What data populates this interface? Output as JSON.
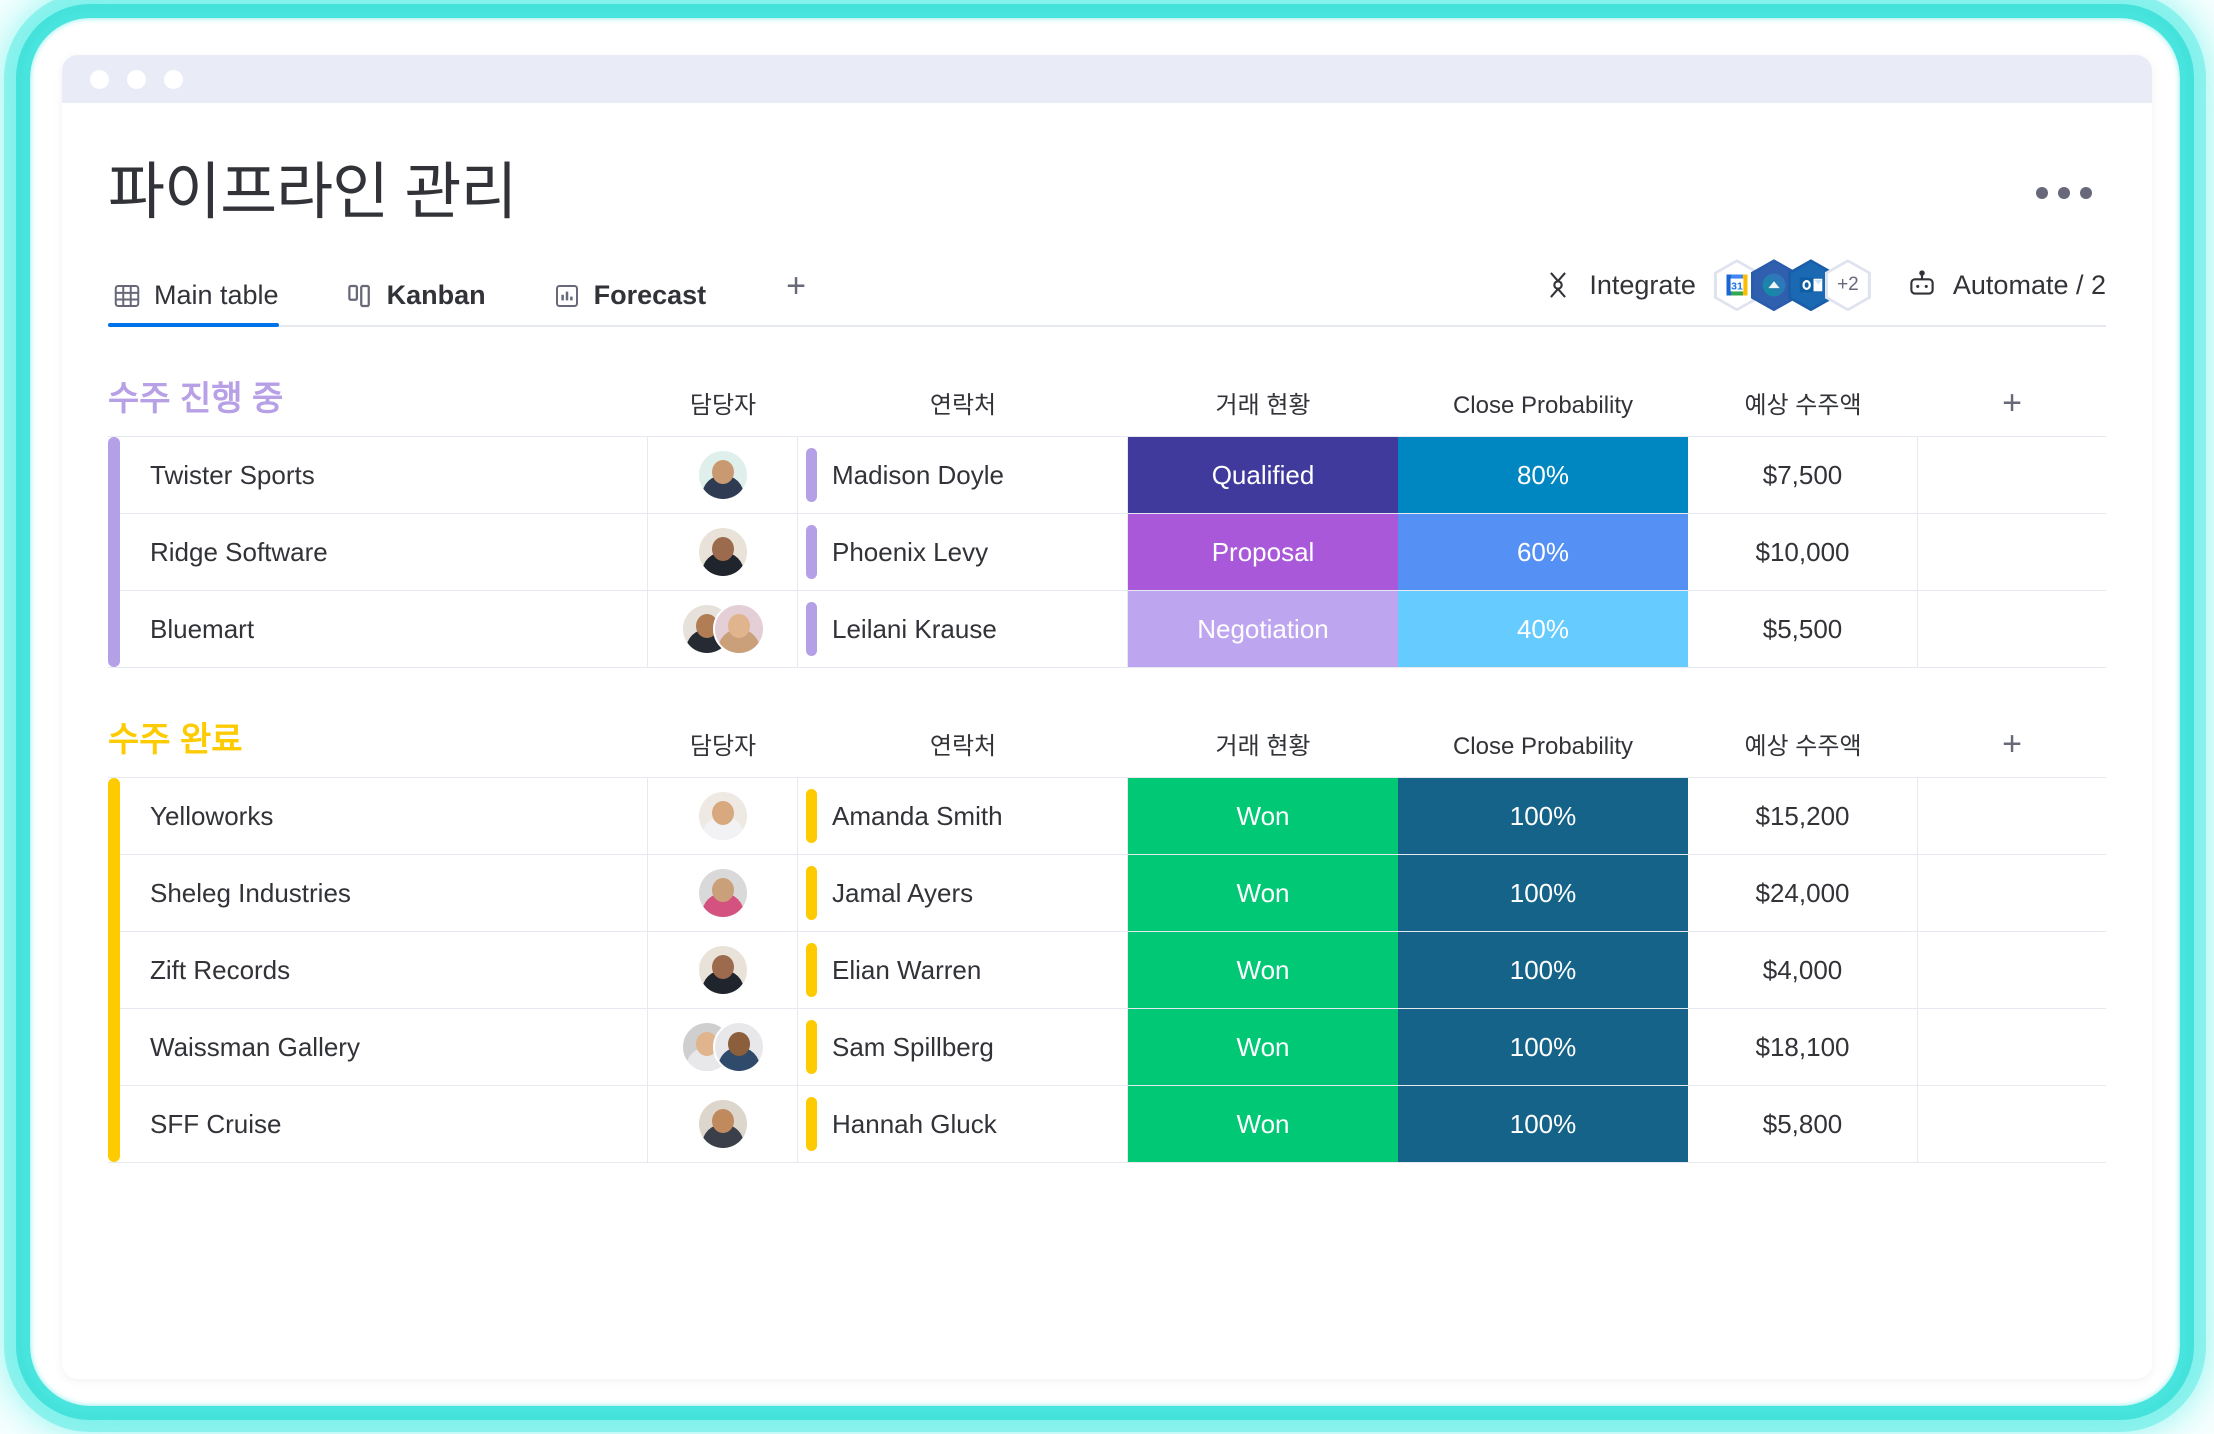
{
  "window": {
    "dots": [
      "dot-1",
      "dot-2",
      "dot-3"
    ]
  },
  "header": {
    "title": "파이프라인 관리",
    "more_menu": "…"
  },
  "tabs": [
    {
      "label": "Main table",
      "icon": "table-icon",
      "active": true
    },
    {
      "label": "Kanban",
      "icon": "kanban-icon",
      "active": false
    },
    {
      "label": "Forecast",
      "icon": "chart-bar-icon",
      "active": false
    }
  ],
  "add_tab_label": "+",
  "toolbar": {
    "integrate_label": "Integrate",
    "integrate_icon": "integrate-icon",
    "automate_label": "Automate / 2",
    "automate_icon": "robot-icon",
    "integration_apps": [
      {
        "name": "google-calendar-icon",
        "label": "31"
      },
      {
        "name": "monday-integration-icon",
        "label": ""
      },
      {
        "name": "outlook-icon",
        "label": "O"
      },
      {
        "name": "more-integrations-badge",
        "label": "+2"
      }
    ]
  },
  "columns": {
    "name": "",
    "owner": "담당자",
    "contact": "연락처",
    "status": "거래 현황",
    "probability": "Close Probability",
    "amount": "예상 수주액",
    "add": "+"
  },
  "colors": {
    "group_in_progress": "#a museum",
    "accent_blue": "#0073ea",
    "purple_group": "#b5a0e8",
    "yellow_group": "#fdcb00",
    "status_qualified": "#403a9c",
    "status_proposal": "#a councils",
    "won_green": "#00c875",
    "prob_100": "#156388"
  },
  "groups": [
    {
      "title": "수주 진행 중",
      "title_color": "#b7a0e6",
      "bar_color": "#b4a0e6",
      "rows": [
        {
          "name": "Twister Sports",
          "owner_avatars": [
            "avatar-male-teal"
          ],
          "contact": "Madison Doyle",
          "contact_bar": "#b4a0e6",
          "status": "Qualified",
          "status_color": "#403a9c",
          "probability": "80%",
          "probability_color": "#0086c0",
          "amount": "$7,500"
        },
        {
          "name": "Ridge Software",
          "owner_avatars": [
            "avatar-female-dark"
          ],
          "contact": "Phoenix Levy",
          "contact_bar": "#b4a0e6",
          "status": "Proposal",
          "status_color": "#a councils",
          "probability": "60%",
          "probability_color": "#5590f5",
          "amount": "$10,000"
        },
        {
          "name": "Bluemart",
          "owner_avatars": [
            "avatar-male-dark",
            "avatar-female-blonde"
          ],
          "contact": "Leilani Krause",
          "contact_bar": "#b4a0e6",
          "status": "Negotiation",
          "status_color": "#bda5f0",
          "probability": "40%",
          "probability_color": "#66ccff",
          "amount": "$5,500"
        }
      ]
    },
    {
      "title": "수주 완료",
      "title_color": "#fdcb00",
      "bar_color": "#fdcb00",
      "rows": [
        {
          "name": "Yelloworks",
          "owner_avatars": [
            "avatar-female-auburn"
          ],
          "contact": "Amanda Smith",
          "contact_bar": "#fdcb00",
          "status": "Won",
          "status_color": "#00c875",
          "probability": "100%",
          "probability_color": "#156388",
          "amount": "$15,200"
        },
        {
          "name": "Sheleg Industries",
          "owner_avatars": [
            "avatar-male-beard"
          ],
          "contact": "Jamal Ayers",
          "contact_bar": "#fdcb00",
          "status": "Won",
          "status_color": "#00c875",
          "probability": "100%",
          "probability_color": "#156388",
          "amount": "$24,000"
        },
        {
          "name": "Zift Records",
          "owner_avatars": [
            "avatar-female-dark"
          ],
          "contact": "Elian Warren",
          "contact_bar": "#fdcb00",
          "status": "Won",
          "status_color": "#00c875",
          "probability": "100%",
          "probability_color": "#156388",
          "amount": "$4,000"
        },
        {
          "name": "Waissman Gallery",
          "owner_avatars": [
            "avatar-female-brown",
            "avatar-male-cap"
          ],
          "contact": "Sam Spillberg",
          "contact_bar": "#fdcb00",
          "status": "Won",
          "status_color": "#00c875",
          "probability": "100%",
          "probability_color": "#156388",
          "amount": "$18,100"
        },
        {
          "name": "SFF Cruise",
          "owner_avatars": [
            "avatar-male-young"
          ],
          "contact": "Hannah Gluck",
          "contact_bar": "#fdcb00",
          "status": "Won",
          "status_color": "#00c875",
          "probability": "100%",
          "probability_color": "#156388",
          "amount": "$5,800"
        }
      ]
    }
  ]
}
